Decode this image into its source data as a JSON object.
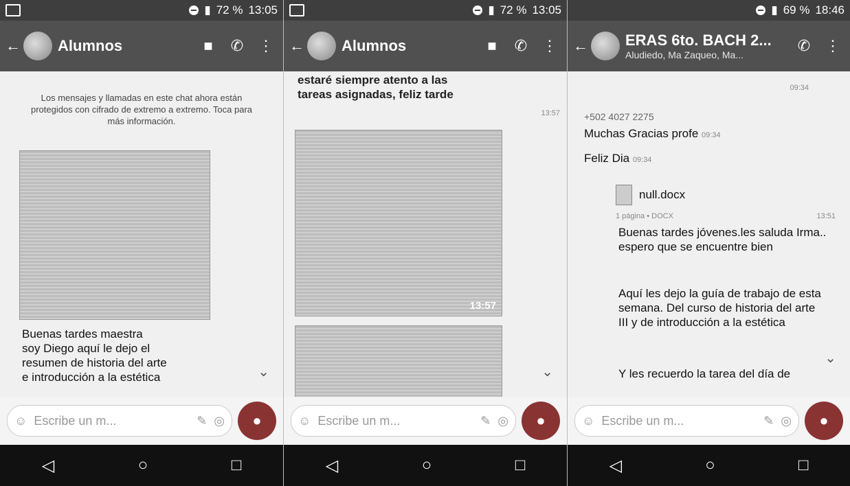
{
  "screens": [
    {
      "status": {
        "battery": "72 %",
        "time": "13:05"
      },
      "title": "Alumnos",
      "encryption_note": "Los mensajes y llamadas en este chat ahora están protegidos con cifrado de extremo a extremo. Toca para más información.",
      "message": "Buenas tardes maestra\nsoy Diego aquí le dejo el\nresumen de historia del arte\ne introducción a la estética",
      "input_placeholder": "Escribe un m..."
    },
    {
      "status": {
        "battery": "72 %",
        "time": "13:05"
      },
      "title": "Alumnos",
      "message_top": "estaré siempre atento a las\ntareas asignadas,  feliz tarde",
      "top_time": "13:57",
      "image_time": "13:57",
      "input_placeholder": "Escribe un m..."
    },
    {
      "status": {
        "battery": "69 %",
        "time": "18:46"
      },
      "title": "ERAS 6to. BACH 2...",
      "subtitle": "Aludiedo, Ma Zaqueo, Ma...",
      "top_time": "09:34",
      "phone_number": "+502 4027 2275",
      "msg1": "Muchas Gracias profe",
      "msg1_time": "09:34",
      "msg2": "Feliz Dia",
      "msg2_time": "09:34",
      "doc_name": "null.docx",
      "doc_meta": "1 página • DOCX",
      "doc_time": "13:51",
      "msg3": "Buenas tardes jóvenes.les saluda Irma.. espero que se encuentre bien",
      "msg4": "Aquí les dejo la guía de trabajo de esta semana. Del curso de historia del arte III y de introducción a la estética",
      "msg5": "Y les recuerdo la tarea del día de",
      "input_placeholder": "Escribe un m..."
    }
  ]
}
